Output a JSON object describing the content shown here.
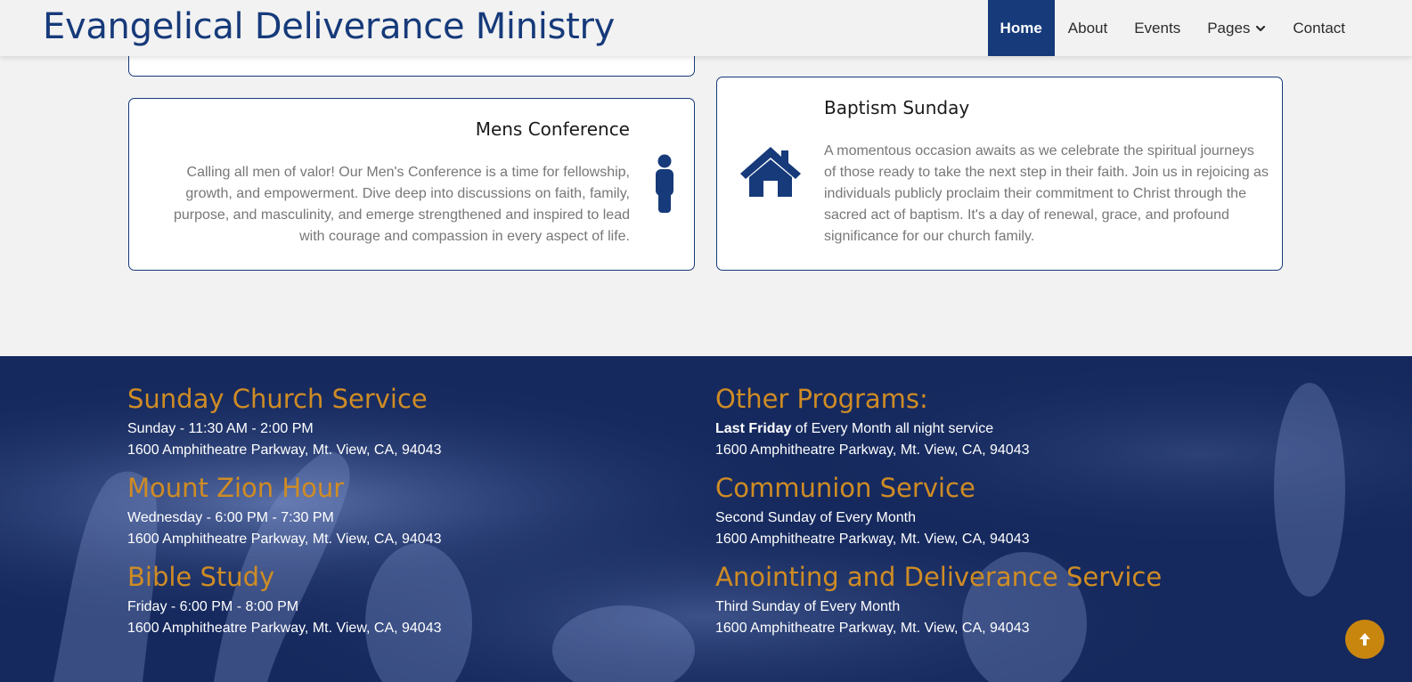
{
  "header": {
    "brand": "Evangelical Deliverance Ministry",
    "nav": [
      {
        "label": "Home",
        "active": true
      },
      {
        "label": "About"
      },
      {
        "label": "Events"
      },
      {
        "label": "Pages",
        "has_dropdown": true
      },
      {
        "label": "Contact"
      }
    ]
  },
  "cards": {
    "mens": {
      "title": "Mens Conference",
      "text": "Calling all men of valor! Our Men's Conference is a time for fellowship, growth, and empowerment. Dive deep into discussions on faith, family, purpose, and masculinity, and emerge strengthened and inspired to lead with courage and compassion in every aspect of life.",
      "icon": "person-icon"
    },
    "baptism": {
      "title": "Baptism Sunday",
      "text": "A momentous occasion awaits as we celebrate the spiritual journeys of those ready to take the next step in their faith. Join us in rejoicing as individuals publicly proclaim their commitment to Christ through the sacred act of baptism. It's a day of renewal, grace, and profound significance for our church family.",
      "icon": "home-icon"
    }
  },
  "services": {
    "left": [
      {
        "title": "Sunday Church Service",
        "line1": "Sunday - 11:30 AM - 2:00 PM",
        "line2": "1600 Amphitheatre Parkway, Mt. View, CA, 94043"
      },
      {
        "title": "Mount Zion Hour",
        "line1": "Wednesday - 6:00 PM - 7:30 PM",
        "line2": "1600 Amphitheatre Parkway, Mt. View, CA, 94043"
      },
      {
        "title": "Bible Study",
        "line1": "Friday - 6:00 PM - 8:00 PM",
        "line2": "1600 Amphitheatre Parkway, Mt. View, CA, 94043"
      }
    ],
    "right": [
      {
        "title": "Other Programs:",
        "line1_bold": "Last Friday",
        "line1_rest": " of Every Month all night service",
        "line2": "1600 Amphitheatre Parkway, Mt. View, CA, 94043"
      },
      {
        "title": "Communion Service",
        "line1": "Second Sunday of Every Month",
        "line2": "1600 Amphitheatre Parkway, Mt. View, CA, 94043"
      },
      {
        "title": "Anointing and Deliverance Service",
        "line1": "Third Sunday of Every Month",
        "line2": "1600 Amphitheatre Parkway, Mt. View, CA, 94043"
      }
    ]
  },
  "colors": {
    "brand_blue": "#163a7a",
    "accent_gold": "#cf8c24",
    "footer_bg": "#15295e"
  },
  "back_to_top": {
    "icon": "arrow-up-icon"
  }
}
